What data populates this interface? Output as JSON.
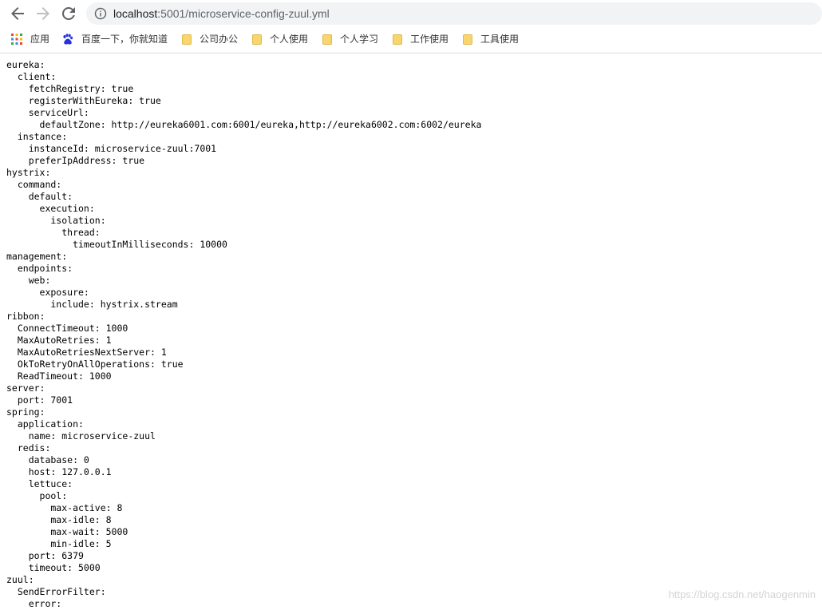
{
  "browser": {
    "url_host": "localhost",
    "url_path": ":5001/microservice-config-zuul.yml",
    "bookmarks": [
      {
        "label": "应用",
        "icon": "apps-grid-icon"
      },
      {
        "label": "百度一下，你就知道",
        "icon": "baidu-paw-icon"
      },
      {
        "label": "公司办公",
        "icon": "folder-icon"
      },
      {
        "label": "个人使用",
        "icon": "folder-icon"
      },
      {
        "label": "个人学习",
        "icon": "folder-icon"
      },
      {
        "label": "工作使用",
        "icon": "folder-icon"
      },
      {
        "label": "工具使用",
        "icon": "folder-icon"
      }
    ]
  },
  "document": {
    "lines": [
      "eureka:",
      "  client:",
      "    fetchRegistry: true",
      "    registerWithEureka: true",
      "    serviceUrl:",
      "      defaultZone: http://eureka6001.com:6001/eureka,http://eureka6002.com:6002/eureka",
      "  instance:",
      "    instanceId: microservice-zuul:7001",
      "    preferIpAddress: true",
      "hystrix:",
      "  command:",
      "    default:",
      "      execution:",
      "        isolation:",
      "          thread:",
      "            timeoutInMilliseconds: 10000",
      "management:",
      "  endpoints:",
      "    web:",
      "      exposure:",
      "        include: hystrix.stream",
      "ribbon:",
      "  ConnectTimeout: 1000",
      "  MaxAutoRetries: 1",
      "  MaxAutoRetriesNextServer: 1",
      "  OkToRetryOnAllOperations: true",
      "  ReadTimeout: 1000",
      "server:",
      "  port: 7001",
      "spring:",
      "  application:",
      "    name: microservice-zuul",
      "  redis:",
      "    database: 0",
      "    host: 127.0.0.1",
      "    lettuce:",
      "      pool:",
      "        max-active: 8",
      "        max-idle: 8",
      "        max-wait: 5000",
      "        min-idle: 5",
      "    port: 6379",
      "    timeout: 5000",
      "zuul:",
      "  SendErrorFilter:",
      "    error:"
    ]
  },
  "watermark": "https://blog.csdn.net/haogenmin"
}
